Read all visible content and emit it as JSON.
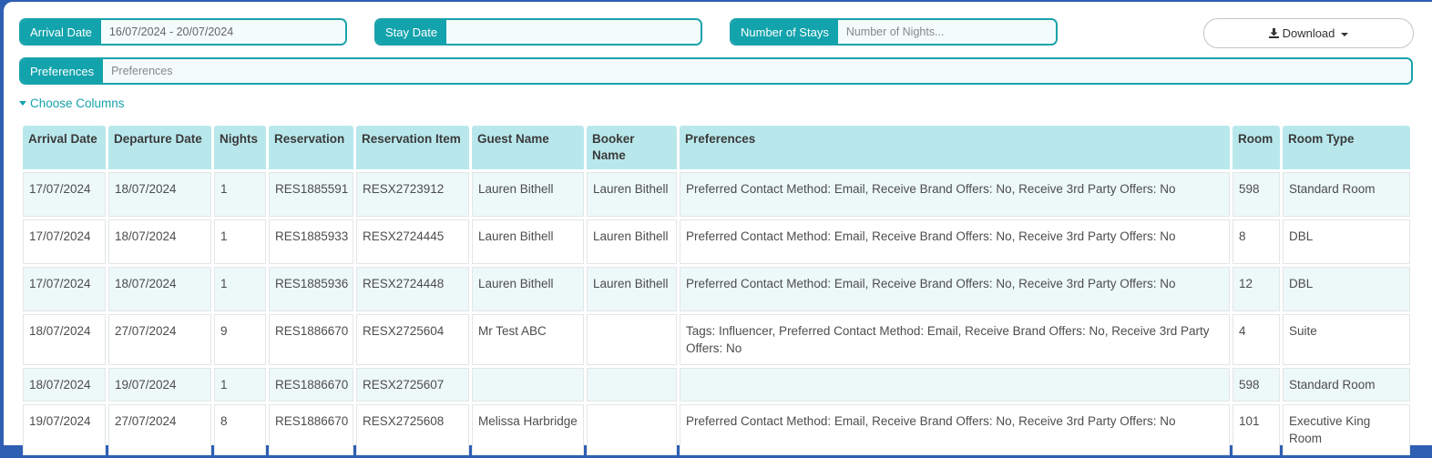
{
  "filters": {
    "arrival_date": {
      "label": "Arrival Date",
      "value": "16/07/2024 - 20/07/2024",
      "placeholder": ""
    },
    "stay_date": {
      "label": "Stay Date",
      "value": "",
      "placeholder": ""
    },
    "number_of_stays": {
      "label": "Number of Stays",
      "value": "",
      "placeholder": "Number of Nights..."
    },
    "preferences": {
      "label": "Preferences",
      "value": "",
      "placeholder": "Preferences"
    }
  },
  "download": {
    "label": "Download",
    "icon": "download-icon"
  },
  "choose_columns": {
    "label": "Choose Columns"
  },
  "table": {
    "headers": [
      "Arrival Date",
      "Departure Date",
      "Nights",
      "Reservation",
      "Reservation Item",
      "Guest Name",
      "Booker Name",
      "Preferences",
      "Room",
      "Room Type"
    ],
    "rows": [
      [
        "17/07/2024",
        "18/07/2024",
        "1",
        "RES1885591",
        "RESX2723912",
        "Lauren Bithell",
        "Lauren Bithell",
        "Preferred Contact Method: Email, Receive Brand Offers: No, Receive 3rd Party Offers: No",
        "598",
        "Standard Room"
      ],
      [
        "17/07/2024",
        "18/07/2024",
        "1",
        "RES1885933",
        "RESX2724445",
        "Lauren Bithell",
        "Lauren Bithell",
        "Preferred Contact Method: Email, Receive Brand Offers: No, Receive 3rd Party Offers: No",
        "8",
        "DBL"
      ],
      [
        "17/07/2024",
        "18/07/2024",
        "1",
        "RES1885936",
        "RESX2724448",
        "Lauren Bithell",
        "Lauren Bithell",
        "Preferred Contact Method: Email, Receive Brand Offers: No, Receive 3rd Party Offers: No",
        "12",
        "DBL"
      ],
      [
        "18/07/2024",
        "27/07/2024",
        "9",
        "RES1886670",
        "RESX2725604",
        "Mr Test ABC",
        "",
        "Tags: Influencer, Preferred Contact Method: Email, Receive Brand Offers: No, Receive 3rd Party Offers: No",
        "4",
        "Suite"
      ],
      [
        "18/07/2024",
        "19/07/2024",
        "1",
        "RES1886670",
        "RESX2725607",
        "",
        "",
        "",
        "598",
        "Standard Room"
      ],
      [
        "19/07/2024",
        "27/07/2024",
        "8",
        "RES1886670",
        "RESX2725608",
        "Melissa Harbridge",
        "",
        "Preferred Contact Method: Email, Receive Brand Offers: No, Receive 3rd Party Offers: No",
        "101",
        "Executive King Room"
      ]
    ]
  },
  "colors": {
    "accent": "#12a3ac",
    "header_bg": "#b9e8ec",
    "row_alt": "#edf8f9"
  }
}
